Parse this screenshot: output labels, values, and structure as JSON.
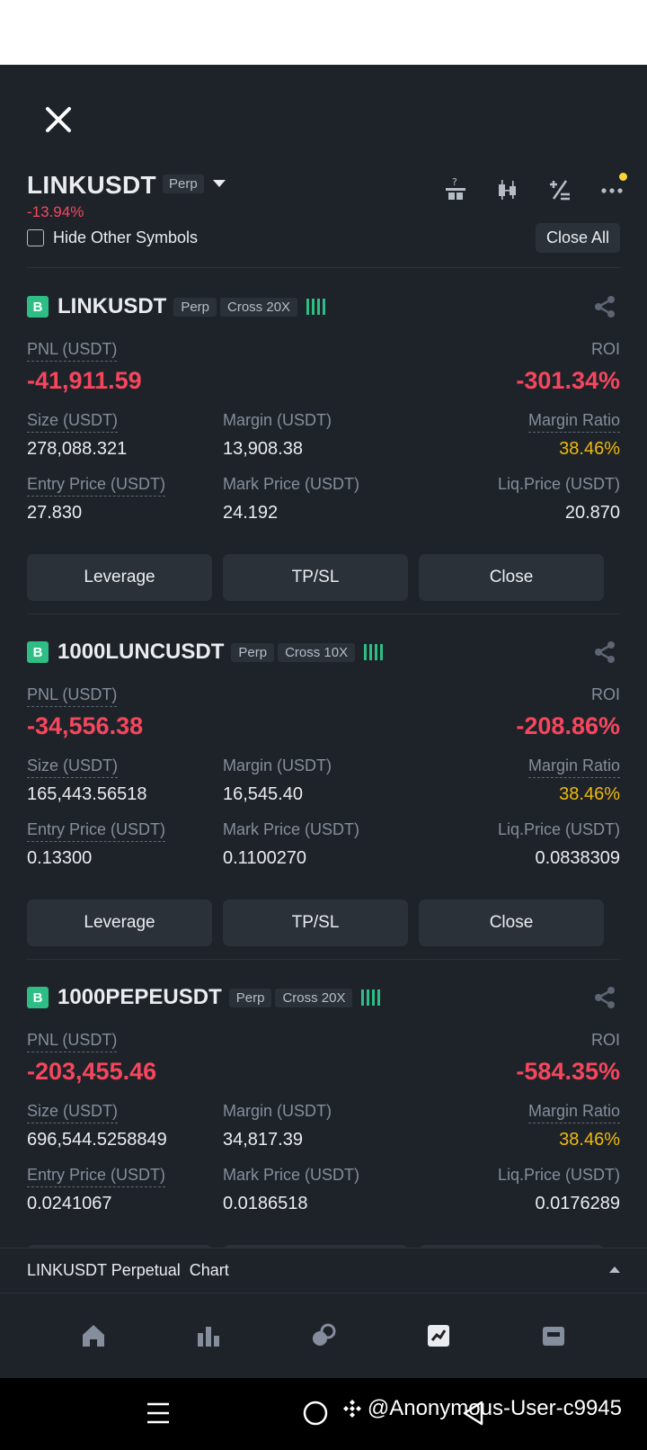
{
  "header": {
    "symbol": "LINKUSDT",
    "type_tag": "Perp",
    "change": "-13.94%",
    "hide_other_label": "Hide Other Symbols",
    "close_all_label": "Close All"
  },
  "labels": {
    "pnl": "PNL (USDT)",
    "roi": "ROI",
    "size": "Size (USDT)",
    "margin": "Margin (USDT)",
    "margin_ratio": "Margin Ratio",
    "entry_price": "Entry Price (USDT)",
    "mark_price": "Mark Price (USDT)",
    "liq_price": "Liq.Price (USDT)",
    "leverage_btn": "Leverage",
    "tpsl_btn": "TP/SL",
    "close_btn": "Close"
  },
  "positions": [
    {
      "badge": "B",
      "symbol": "LINKUSDT",
      "type": "Perp",
      "mode": "Cross 20X",
      "pnl": "-41,911.59",
      "roi": "-301.34%",
      "size": "278,088.321",
      "margin": "13,908.38",
      "margin_ratio": "38.46%",
      "entry_price": "27.830",
      "mark_price": "24.192",
      "liq_price": "20.870"
    },
    {
      "badge": "B",
      "symbol": "1000LUNCUSDT",
      "type": "Perp",
      "mode": "Cross 10X",
      "pnl": "-34,556.38",
      "roi": "-208.86%",
      "size": "165,443.56518",
      "margin": "16,545.40",
      "margin_ratio": "38.46%",
      "entry_price": "0.13300",
      "mark_price": "0.1100270",
      "liq_price": "0.0838309"
    },
    {
      "badge": "B",
      "symbol": "1000PEPEUSDT",
      "type": "Perp",
      "mode": "Cross 20X",
      "pnl": "-203,455.46",
      "roi": "-584.35%",
      "size": "696,544.5258849",
      "margin": "34,817.39",
      "margin_ratio": "38.46%",
      "entry_price": "0.0241067",
      "mark_price": "0.0186518",
      "liq_price": "0.0176289"
    }
  ],
  "chart_bar": {
    "label": "LINKUSDT Perpetual  Chart"
  },
  "tabs": [
    "home-icon",
    "markets-icon",
    "trade-icon",
    "futures-icon",
    "wallet-icon"
  ],
  "watermark": "@Anonymous-User-c9945",
  "colors": {
    "background": "#1e2329",
    "negative": "#f6465d",
    "positive": "#2ebd85",
    "warning": "#f0b90b"
  }
}
